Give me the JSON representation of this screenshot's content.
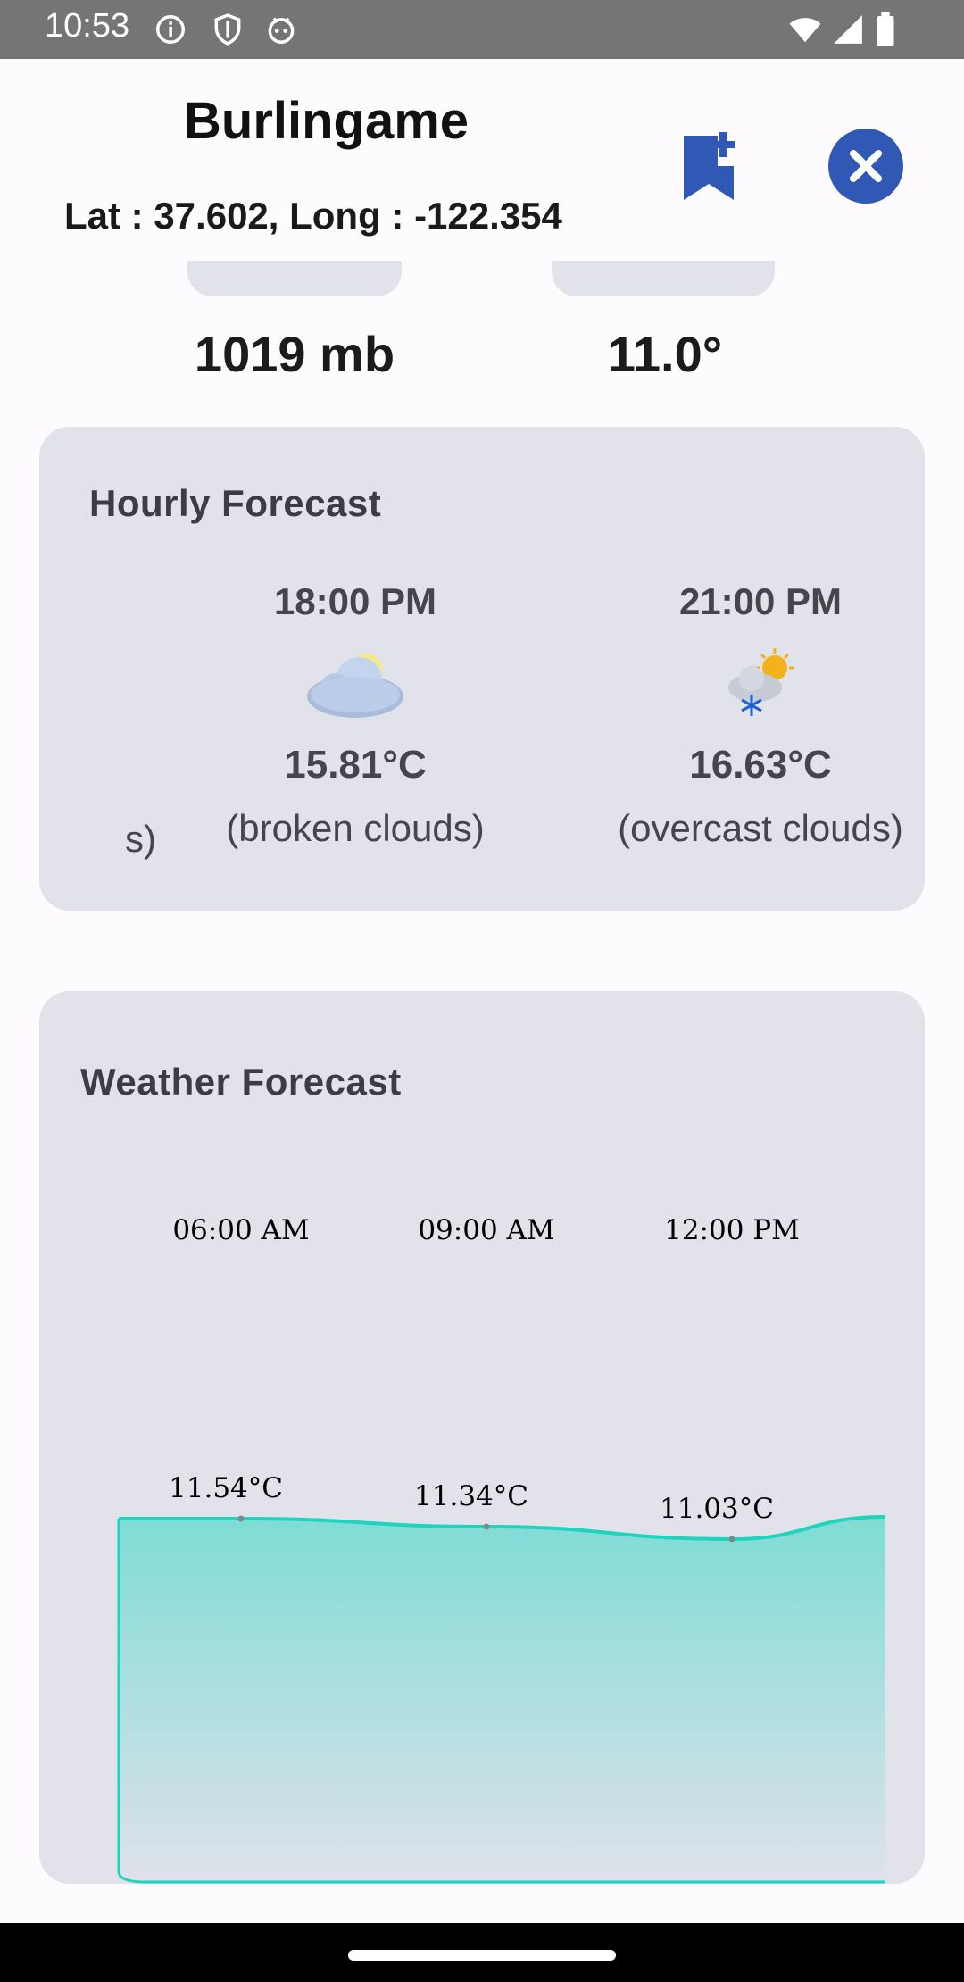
{
  "status_bar": {
    "time": "10:53",
    "left_icons": [
      "info-icon",
      "shield-icon",
      "android-icon"
    ],
    "right_icons": [
      "wifi-icon",
      "signal-icon",
      "battery-icon"
    ]
  },
  "header": {
    "city": "Burlingame",
    "coords": "Lat : 37.602, Long : -122.354",
    "bookmark_icon": "bookmark-add-icon",
    "close_icon": "close-icon"
  },
  "metrics": {
    "pressure": "1019 mb",
    "value2": "11.0°"
  },
  "hourly": {
    "title": "Hourly Forecast",
    "partial_left_desc": "s)",
    "items": [
      {
        "time": "18:00 PM",
        "icon": "cloud-icon",
        "temp": "15.81°C",
        "desc": "(broken clouds)"
      },
      {
        "time": "21:00 PM",
        "icon": "snow-sun-cloud-icon",
        "temp": "16.63°C",
        "desc": "(overcast clouds)"
      }
    ]
  },
  "forecast": {
    "title": "Weather Forecast"
  },
  "chart_data": {
    "type": "area",
    "title": "Weather Forecast",
    "x": [
      "06:00 AM",
      "09:00 AM",
      "12:00 PM"
    ],
    "series": [
      {
        "values": [
          11.54,
          11.34,
          11.03
        ],
        "labels": [
          "11.54°C",
          "11.34°C",
          "11.03°C"
        ]
      }
    ],
    "colors": {
      "line": "#1fd4bd",
      "fill_top": "#7fdcd6",
      "fill_bottom": "#dfe1ea"
    },
    "grid": false
  }
}
